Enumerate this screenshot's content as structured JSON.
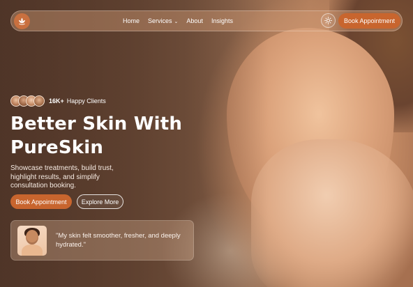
{
  "navbar": {
    "logo_icon": "lotus-icon",
    "links": [
      {
        "label": "Home"
      },
      {
        "label": "Services",
        "icon": "chevron-down-icon"
      },
      {
        "label": "About"
      },
      {
        "label": "Insights"
      }
    ],
    "theme_toggle_icon": "sun-icon",
    "cta_label": "Book Appointment"
  },
  "hero": {
    "clients_count": "16K+",
    "clients_label": "Happy Clients",
    "headline_line1": "Better Skin With",
    "headline_line2": "PureSkin",
    "subtext": "Showcase treatments, build trust, highlight results, and simplify consultation booking.",
    "primary_cta": "Book Appointment",
    "secondary_cta": "Explore More"
  },
  "testimonial": {
    "quote": "\"My skin felt smoother, fresher, and deeply hydrated.\""
  },
  "colors": {
    "accent": "#c8652e",
    "nav_glass": "#d6a07a"
  }
}
